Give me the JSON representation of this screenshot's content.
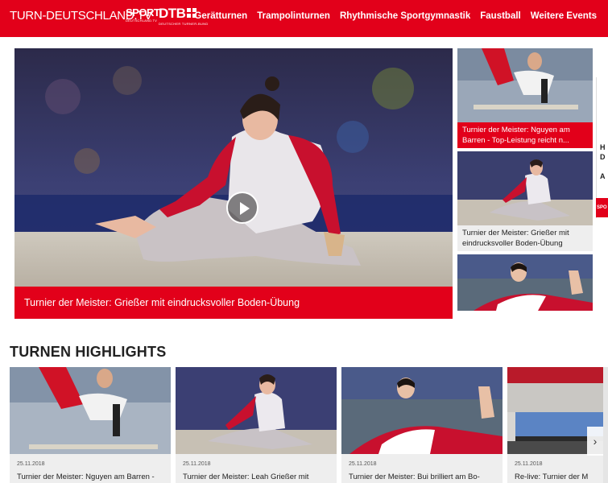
{
  "header": {
    "logo": "TURN-DEUTSCHLAND.TV",
    "sport_logo": "SPORT",
    "sport_logo_sub": "DEUTSCHLAND.TV",
    "dtb_logo": "DTB",
    "dtb_logo_sub": "DEUTSCHER TURNER-BUND",
    "nav": [
      "Gerätturnen",
      "Trampolinturnen",
      "Rhythmische Sportgymnastik",
      "Faustball",
      "Weitere Events"
    ]
  },
  "hero": {
    "caption": "Turnier der Meister: Grießer mit eindrucksvoller Boden-Übung"
  },
  "side_cards": [
    {
      "line1": "Turnier der Meister: Nguyen am",
      "line2": "Barren - Top-Leistung reicht n..."
    },
    {
      "line1": "Turnier der Meister: Grießer mit",
      "line2": "eindrucksvoller Boden-Übung"
    },
    {
      "line1": "",
      "line2": ""
    }
  ],
  "edge_ad": {
    "letters": [
      "H",
      "D",
      "A"
    ],
    "badge": "SPO"
  },
  "highlights": {
    "title": "TURNEN HIGHLIGHTS",
    "cards": [
      {
        "date": "25.11.2018",
        "title": "Turnier der Meister: Nguyen am Barren -"
      },
      {
        "date": "25.11.2018",
        "title": "Turnier der Meister: Leah Grießer mit"
      },
      {
        "date": "25.11.2018",
        "title": "Turnier der Meister: Bui brilliert am Bo-"
      },
      {
        "date": "25.11.2018",
        "title": "Re-live: Turnier der M"
      }
    ],
    "next_arrow": "›"
  },
  "colors": {
    "brand_red": "#e2001a",
    "card_gray": "#eeeeee"
  }
}
